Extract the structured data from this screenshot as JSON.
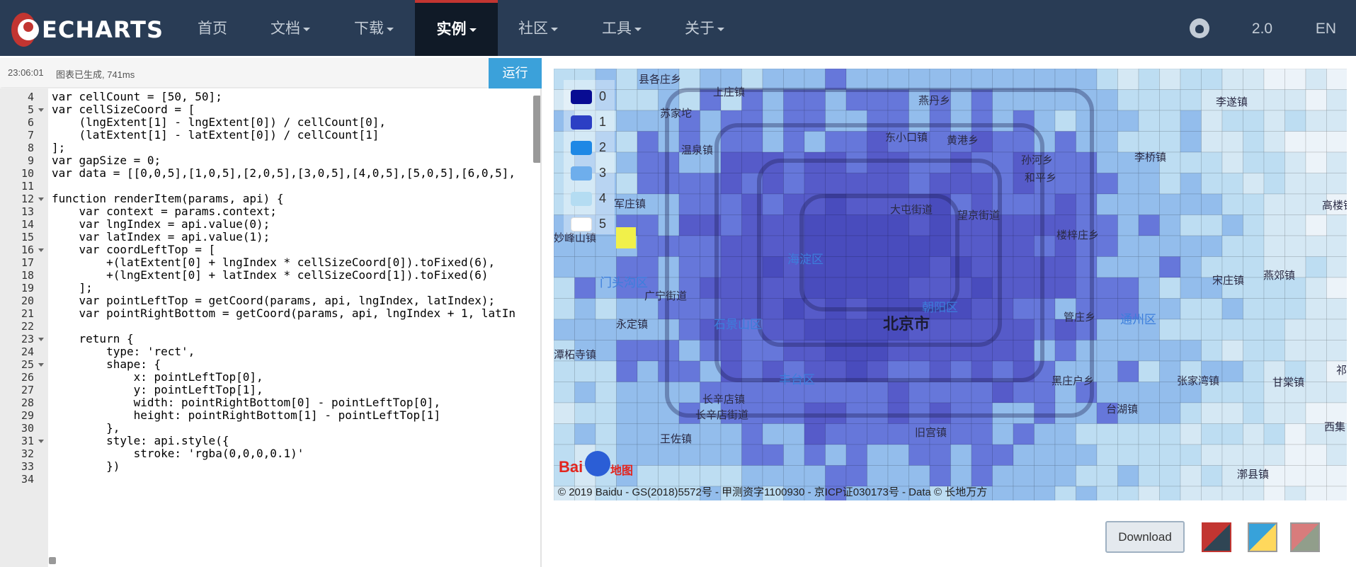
{
  "brand": {
    "name": "ECHARTS"
  },
  "nav": {
    "items": [
      {
        "label": "首页",
        "dropdown": false
      },
      {
        "label": "文档",
        "dropdown": true
      },
      {
        "label": "下载",
        "dropdown": true
      },
      {
        "label": "实例",
        "dropdown": true,
        "active": true
      },
      {
        "label": "社区",
        "dropdown": true
      },
      {
        "label": "工具",
        "dropdown": true
      },
      {
        "label": "关于",
        "dropdown": true
      }
    ],
    "version": "2.0",
    "lang": "EN",
    "github_icon": "github-icon"
  },
  "status": {
    "time": "23:06:01",
    "message": "图表已生成, 741ms",
    "run_label": "运行"
  },
  "editor": {
    "lines": [
      {
        "n": "4",
        "fold": false,
        "text": "var cellCount = [50, 50];"
      },
      {
        "n": "5",
        "fold": true,
        "text": "var cellSizeCoord = ["
      },
      {
        "n": "6",
        "fold": false,
        "text": "    (lngExtent[1] - lngExtent[0]) / cellCount[0],"
      },
      {
        "n": "7",
        "fold": false,
        "text": "    (latExtent[1] - latExtent[0]) / cellCount[1]"
      },
      {
        "n": "8",
        "fold": false,
        "text": "];"
      },
      {
        "n": "9",
        "fold": false,
        "text": "var gapSize = 0;"
      },
      {
        "n": "10",
        "fold": false,
        "text": "var data = [[0,0,5],[1,0,5],[2,0,5],[3,0,5],[4,0,5],[5,0,5],[6,0,5],"
      },
      {
        "n": "11",
        "fold": false,
        "text": ""
      },
      {
        "n": "12",
        "fold": true,
        "text": "function renderItem(params, api) {"
      },
      {
        "n": "13",
        "fold": false,
        "text": "    var context = params.context;"
      },
      {
        "n": "14",
        "fold": false,
        "text": "    var lngIndex = api.value(0);"
      },
      {
        "n": "15",
        "fold": false,
        "text": "    var latIndex = api.value(1);"
      },
      {
        "n": "16",
        "fold": true,
        "text": "    var coordLeftTop = ["
      },
      {
        "n": "17",
        "fold": false,
        "text": "        +(latExtent[0] + lngIndex * cellSizeCoord[0]).toFixed(6),"
      },
      {
        "n": "18",
        "fold": false,
        "text": "        +(lngExtent[0] + latIndex * cellSizeCoord[1]).toFixed(6)"
      },
      {
        "n": "19",
        "fold": false,
        "text": "    ];"
      },
      {
        "n": "20",
        "fold": false,
        "text": "    var pointLeftTop = getCoord(params, api, lngIndex, latIndex);"
      },
      {
        "n": "21",
        "fold": false,
        "text": "    var pointRightBottom = getCoord(params, api, lngIndex + 1, latIn"
      },
      {
        "n": "22",
        "fold": false,
        "text": ""
      },
      {
        "n": "23",
        "fold": true,
        "text": "    return {"
      },
      {
        "n": "24",
        "fold": false,
        "text": "        type: 'rect',"
      },
      {
        "n": "25",
        "fold": true,
        "text": "        shape: {"
      },
      {
        "n": "26",
        "fold": false,
        "text": "            x: pointLeftTop[0],"
      },
      {
        "n": "27",
        "fold": false,
        "text": "            y: pointLeftTop[1],"
      },
      {
        "n": "28",
        "fold": false,
        "text": "            width: pointRightBottom[0] - pointLeftTop[0],"
      },
      {
        "n": "29",
        "fold": false,
        "text": "            height: pointRightBottom[1] - pointLeftTop[1]"
      },
      {
        "n": "30",
        "fold": false,
        "text": "        },"
      },
      {
        "n": "31",
        "fold": true,
        "text": "        style: api.style({"
      },
      {
        "n": "32",
        "fold": false,
        "text": "            stroke: 'rgba(0,0,0,0.1)'"
      },
      {
        "n": "33",
        "fold": false,
        "text": "        })"
      },
      {
        "n": "34",
        "fold": false,
        "text": ""
      }
    ]
  },
  "map": {
    "legend": [
      {
        "label": "0",
        "color": "#080c93"
      },
      {
        "label": "1",
        "color": "#2c3fc4"
      },
      {
        "label": "2",
        "color": "#1e88e5"
      },
      {
        "label": "3",
        "color": "#6eaeec"
      },
      {
        "label": "4",
        "color": "#b4dcf2"
      },
      {
        "label": "5",
        "color": "#ffffff"
      }
    ],
    "labels": [
      {
        "text": "县各庄乡",
        "type": "town"
      },
      {
        "text": "上庄镇",
        "type": "town"
      },
      {
        "text": "苏家坨",
        "type": "town"
      },
      {
        "text": "燕丹乡",
        "type": "town"
      },
      {
        "text": "李遂镇",
        "type": "town"
      },
      {
        "text": "温泉镇",
        "type": "town"
      },
      {
        "text": "东小口镇",
        "type": "town"
      },
      {
        "text": "黄港乡",
        "type": "town"
      },
      {
        "text": "孙河乡",
        "type": "town"
      },
      {
        "text": "李桥镇",
        "type": "town"
      },
      {
        "text": "和平乡",
        "type": "town"
      },
      {
        "text": "军庄镇",
        "type": "town"
      },
      {
        "text": "大屯街道",
        "type": "town"
      },
      {
        "text": "望京街道",
        "type": "town"
      },
      {
        "text": "高楼镇",
        "type": "town"
      },
      {
        "text": "妙峰山镇",
        "type": "town"
      },
      {
        "text": "楼梓庄乡",
        "type": "town"
      },
      {
        "text": "海淀区",
        "type": "district"
      },
      {
        "text": "门头沟区",
        "type": "district"
      },
      {
        "text": "广宁街道",
        "type": "town"
      },
      {
        "text": "宋庄镇",
        "type": "town"
      },
      {
        "text": "燕郊镇",
        "type": "town"
      },
      {
        "text": "朝阳区",
        "type": "district"
      },
      {
        "text": "北京市",
        "type": "city"
      },
      {
        "text": "永定镇",
        "type": "town"
      },
      {
        "text": "石景山区",
        "type": "district"
      },
      {
        "text": "管庄乡",
        "type": "town"
      },
      {
        "text": "通州区",
        "type": "district"
      },
      {
        "text": "潭柘寺镇",
        "type": "town"
      },
      {
        "text": "丰台区",
        "type": "district"
      },
      {
        "text": "黑庄户乡",
        "type": "town"
      },
      {
        "text": "张家湾镇",
        "type": "town"
      },
      {
        "text": "甘棠镇",
        "type": "town"
      },
      {
        "text": "长辛店镇",
        "type": "town"
      },
      {
        "text": "长辛店街道",
        "type": "town"
      },
      {
        "text": "台湖镇",
        "type": "town"
      },
      {
        "text": "王佐镇",
        "type": "town"
      },
      {
        "text": "旧宫镇",
        "type": "town"
      },
      {
        "text": "西集",
        "type": "town"
      },
      {
        "text": "漷县镇",
        "type": "town"
      },
      {
        "text": "祁",
        "type": "town"
      }
    ],
    "copyright": "© 2019 Baidu - GS(2018)5572号 - 甲测资字1100930 - 京ICP证030173号 - Data © 长地万方",
    "baidu_logo": {
      "bai": "Bai",
      "ditu": "地图"
    }
  },
  "toolbar": {
    "download_label": "Download",
    "themes": [
      {
        "name": "dark-theme",
        "colors": [
          "#c23531",
          "#2f4554"
        ],
        "selected": true
      },
      {
        "name": "light-theme",
        "colors": [
          "#37a2da",
          "#ffd85c"
        ],
        "selected": false
      },
      {
        "name": "vintage-theme",
        "colors": [
          "#d87c7c",
          "#919e8b"
        ],
        "selected": false
      }
    ]
  }
}
